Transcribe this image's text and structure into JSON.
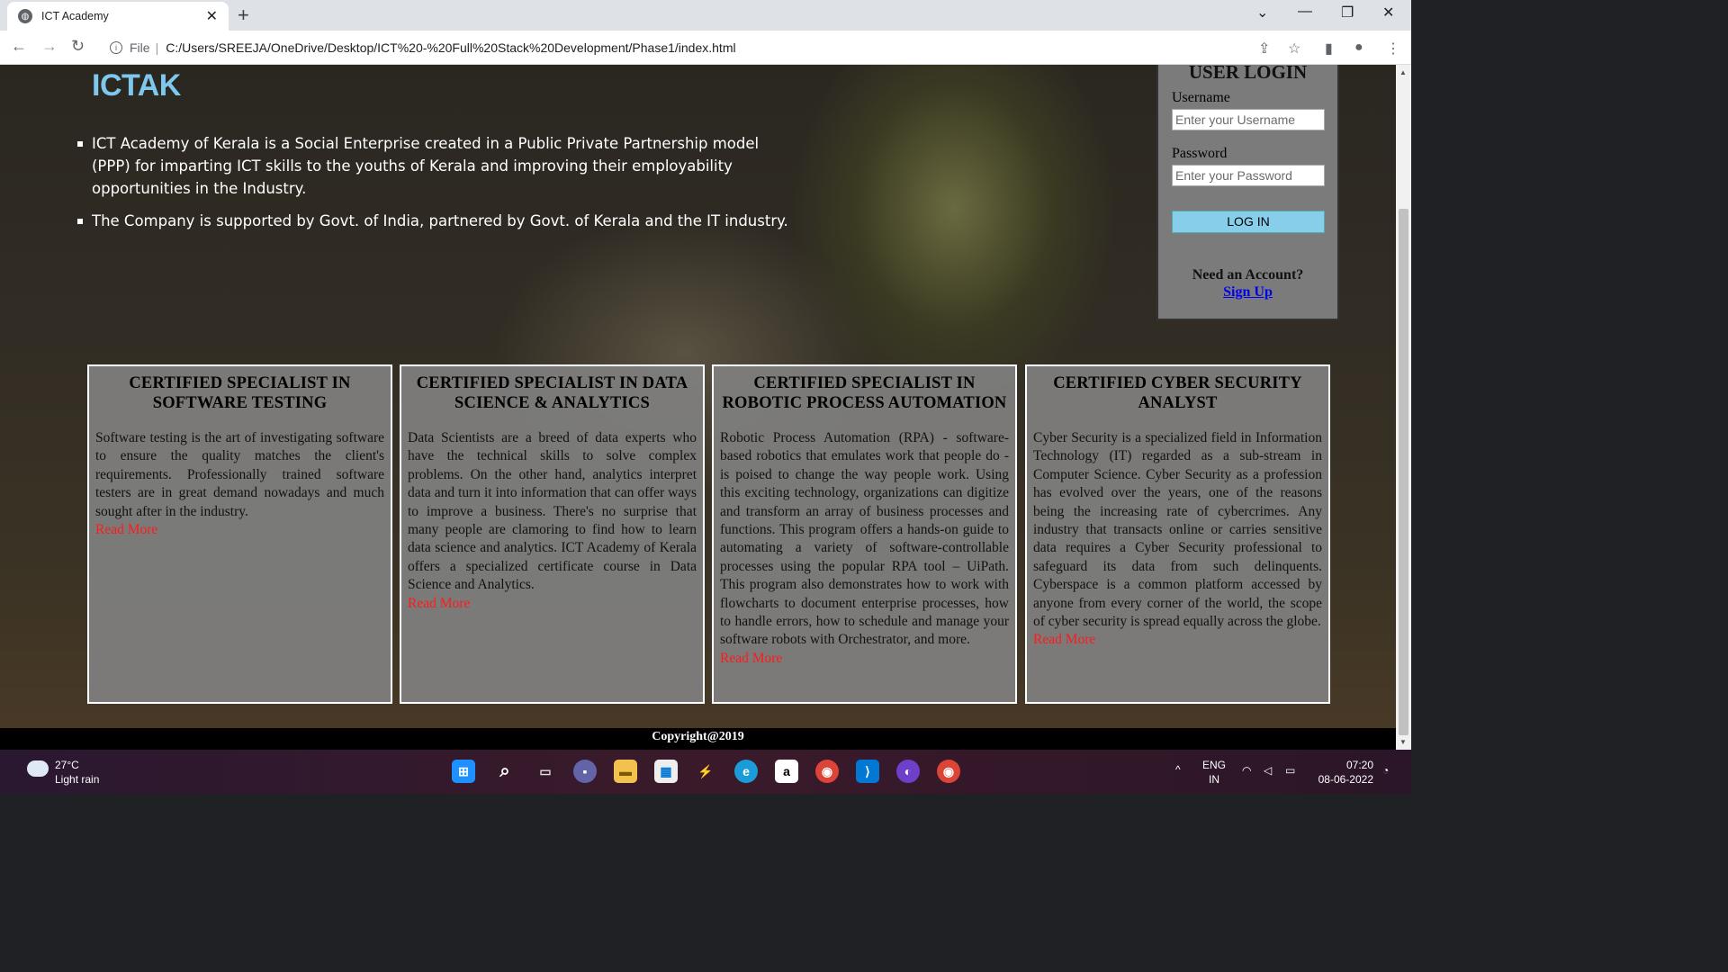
{
  "browser": {
    "tab_title": "ICT Academy",
    "new_tab": "+",
    "url_scheme": "File",
    "url": "C:/Users/SREEJA/OneDrive/Desktop/ICT%20-%20Full%20Stack%20Development/Phase1/index.html"
  },
  "page": {
    "site_title": "ICTAK",
    "intro": [
      "ICT Academy of Kerala is a Social Enterprise created in a Public Private Partnership model (PPP) for imparting ICT skills to the youths of Kerala and improving their employability opportunities in the Industry.",
      "The Company is supported by Govt. of India, partnered by Govt. of Kerala and the IT industry."
    ],
    "login": {
      "heading": "USER LOGIN",
      "username_label": "Username",
      "username_placeholder": "Enter your Username",
      "password_label": "Password",
      "password_placeholder": "Enter your Password",
      "button": "LOG IN",
      "need_account": "Need an Account?",
      "signup": "Sign Up"
    },
    "cards": [
      {
        "title": "CERTIFIED SPECIALIST IN SOFTWARE TESTING",
        "body": "Software testing is the art of investigating software to ensure the quality matches the client's requirements. Professionally trained software testers are in great demand nowadays and much sought after in the industry.",
        "link": "Read More"
      },
      {
        "title": "CERTIFIED SPECIALIST IN DATA SCIENCE & ANALYTICS",
        "body": "Data Scientists are a breed of data experts who have the technical skills to solve complex problems. On the other hand, analytics interpret data and turn it into information that can offer ways to improve a business. There's no surprise that many people are clamoring to find how to learn data science and analytics. ICT Academy of Kerala offers a specialized certificate course in Data Science and Analytics.",
        "link": "Read More"
      },
      {
        "title": "CERTIFIED SPECIALIST IN ROBOTIC PROCESS AUTOMATION",
        "body": "Robotic Process Automation (RPA) - software-based robotics that emulates work that people do - is poised to change the way people work. Using this exciting technology, organizations can digitize and transform an array of business processes and functions. This program offers a hands-on guide to automating a variety of software-controllable processes using the popular RPA tool – UiPath. This program also demonstrates how to work with flowcharts to document enterprise processes, how to handle errors, how to schedule and manage your software robots with Orchestrator, and more.",
        "link": "Read More"
      },
      {
        "title": "CERTIFIED CYBER SECURITY ANALYST",
        "body": "Cyber Security is a specialized field in Information Technology (IT) regarded as a sub-stream in Computer Science. Cyber Security as a profession has evolved over the years, one of the reasons being the increasing rate of cybercrimes. Any industry that transacts online or carries sensitive data requires a Cyber Security professional to safeguard its data from such delinquents. Cyberspace is a common platform accessed by anyone from every corner of the world, the scope of cyber security is spread equally across the globe.",
        "link": "Read More"
      }
    ],
    "footer": "Copyright@2019"
  },
  "taskbar": {
    "temperature": "27°C",
    "weather": "Light rain",
    "lang": "ENG",
    "region": "IN",
    "time": "07:20",
    "date": "08-06-2022"
  }
}
